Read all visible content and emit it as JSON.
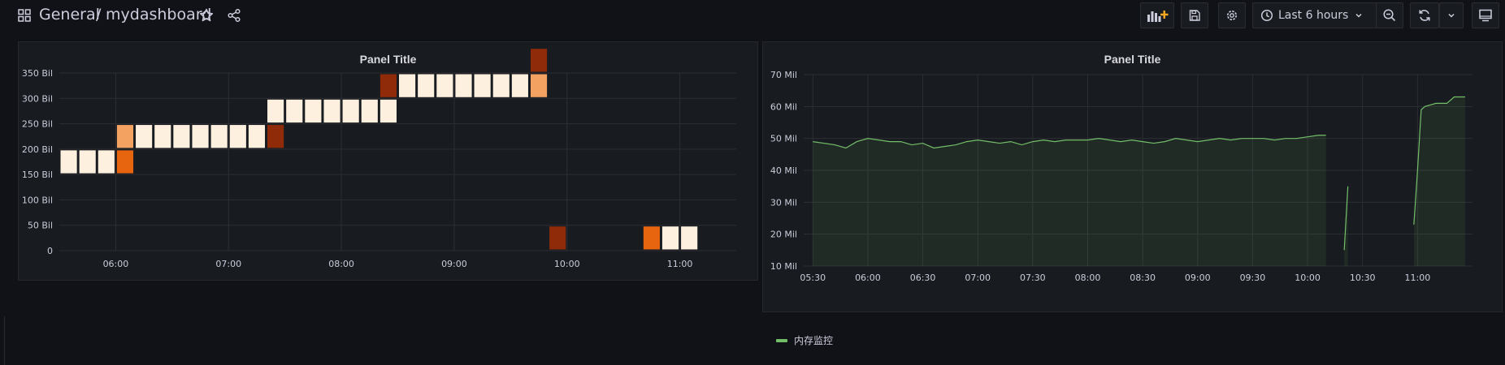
{
  "header": {
    "folder": "General",
    "separator": "/",
    "dashboard": "mydashboard",
    "time_range": "Last 6 hours"
  },
  "toolbar_icons": [
    "add-panel-icon",
    "save-icon",
    "settings-icon",
    "clock-icon",
    "chevron-down-icon",
    "zoom-out-icon",
    "refresh-icon",
    "chevron-down-icon",
    "tv-mode-icon"
  ],
  "colors": {
    "background": "#111217",
    "panel": "#181b1f",
    "series": "#73bf69",
    "heat_low": "#fdf0de",
    "heat_mid": "#f4a261",
    "heat_high": "#e8650f",
    "heat_max": "#8f2b09"
  },
  "panels": [
    {
      "title": "Panel Title",
      "chart_data": {
        "type": "heatmap",
        "x_ticks": [
          "06:00",
          "07:00",
          "08:00",
          "09:00",
          "10:00",
          "11:00"
        ],
        "y_ticks": [
          "0",
          "50 Bil",
          "100 Bil",
          "150 Bil",
          "200 Bil",
          "250 Bil",
          "300 Bil",
          "350 Bil"
        ],
        "ylim": [
          0,
          350
        ],
        "y_unit": "Bil",
        "grid": true,
        "cells": [
          {
            "t": "05:30",
            "y": 200,
            "level": "low"
          },
          {
            "t": "05:40",
            "y": 200,
            "level": "low"
          },
          {
            "t": "05:50",
            "y": 200,
            "level": "low"
          },
          {
            "t": "06:00",
            "y": 200,
            "level": "high"
          },
          {
            "t": "06:00",
            "y": 250,
            "level": "mid"
          },
          {
            "t": "06:10",
            "y": 250,
            "level": "low"
          },
          {
            "t": "06:20",
            "y": 250,
            "level": "low"
          },
          {
            "t": "06:30",
            "y": 250,
            "level": "low"
          },
          {
            "t": "06:40",
            "y": 250,
            "level": "low"
          },
          {
            "t": "06:50",
            "y": 250,
            "level": "low"
          },
          {
            "t": "07:00",
            "y": 250,
            "level": "low"
          },
          {
            "t": "07:10",
            "y": 250,
            "level": "low"
          },
          {
            "t": "07:20",
            "y": 250,
            "level": "max"
          },
          {
            "t": "07:20",
            "y": 300,
            "level": "low"
          },
          {
            "t": "07:30",
            "y": 300,
            "level": "low"
          },
          {
            "t": "07:40",
            "y": 300,
            "level": "low"
          },
          {
            "t": "07:50",
            "y": 300,
            "level": "low"
          },
          {
            "t": "08:00",
            "y": 300,
            "level": "low"
          },
          {
            "t": "08:10",
            "y": 300,
            "level": "low"
          },
          {
            "t": "08:20",
            "y": 300,
            "level": "low"
          },
          {
            "t": "08:20",
            "y": 350,
            "level": "max"
          },
          {
            "t": "08:30",
            "y": 350,
            "level": "low"
          },
          {
            "t": "08:40",
            "y": 350,
            "level": "low"
          },
          {
            "t": "08:50",
            "y": 350,
            "level": "low"
          },
          {
            "t": "09:00",
            "y": 350,
            "level": "low"
          },
          {
            "t": "09:10",
            "y": 350,
            "level": "low"
          },
          {
            "t": "09:20",
            "y": 350,
            "level": "low"
          },
          {
            "t": "09:30",
            "y": 350,
            "level": "low"
          },
          {
            "t": "09:40",
            "y": 350,
            "level": "mid"
          },
          {
            "t": "09:40",
            "y": 400,
            "level": "max"
          },
          {
            "t": "09:50",
            "y": 50,
            "level": "max"
          },
          {
            "t": "10:40",
            "y": 50,
            "level": "high"
          },
          {
            "t": "10:50",
            "y": 50,
            "level": "low"
          },
          {
            "t": "11:00",
            "y": 50,
            "level": "low"
          }
        ]
      }
    },
    {
      "title": "Panel Title",
      "chart_data": {
        "type": "line",
        "x_ticks": [
          "05:30",
          "06:00",
          "06:30",
          "07:00",
          "07:30",
          "08:00",
          "08:30",
          "09:00",
          "09:30",
          "10:00",
          "10:30",
          "11:00"
        ],
        "y_ticks": [
          "10 Mil",
          "20 Mil",
          "30 Mil",
          "40 Mil",
          "50 Mil",
          "60 Mil",
          "70 Mil"
        ],
        "ylim": [
          10,
          70
        ],
        "y_unit": "Mil",
        "grid": true,
        "legend_position": "bottom-left",
        "series": [
          {
            "name": "内存监控",
            "segments": [
              [
                [
                  "05:30",
                  49
                ],
                [
                  "05:36",
                  48.5
                ],
                [
                  "05:42",
                  48
                ],
                [
                  "05:48",
                  47
                ],
                [
                  "05:54",
                  49
                ],
                [
                  "06:00",
                  50
                ],
                [
                  "06:06",
                  49.5
                ],
                [
                  "06:12",
                  49
                ],
                [
                  "06:18",
                  49
                ],
                [
                  "06:24",
                  48
                ],
                [
                  "06:30",
                  48.5
                ],
                [
                  "06:36",
                  47
                ],
                [
                  "06:42",
                  47.5
                ],
                [
                  "06:48",
                  48
                ],
                [
                  "06:54",
                  49
                ],
                [
                  "07:00",
                  49.5
                ],
                [
                  "07:06",
                  49
                ],
                [
                  "07:12",
                  48.5
                ],
                [
                  "07:18",
                  49
                ],
                [
                  "07:24",
                  48
                ],
                [
                  "07:30",
                  49
                ],
                [
                  "07:36",
                  49.5
                ],
                [
                  "07:42",
                  49
                ],
                [
                  "07:48",
                  49.5
                ],
                [
                  "07:54",
                  49.5
                ],
                [
                  "08:00",
                  49.5
                ],
                [
                  "08:06",
                  50
                ],
                [
                  "08:12",
                  49.5
                ],
                [
                  "08:18",
                  49
                ],
                [
                  "08:24",
                  49.5
                ],
                [
                  "08:30",
                  49
                ],
                [
                  "08:36",
                  48.5
                ],
                [
                  "08:42",
                  49
                ],
                [
                  "08:48",
                  50
                ],
                [
                  "08:54",
                  49.5
                ],
                [
                  "09:00",
                  49
                ],
                [
                  "09:06",
                  49.5
                ],
                [
                  "09:12",
                  50
                ],
                [
                  "09:18",
                  49.5
                ],
                [
                  "09:24",
                  50
                ],
                [
                  "09:30",
                  50
                ],
                [
                  "09:36",
                  50
                ],
                [
                  "09:42",
                  49.5
                ],
                [
                  "09:48",
                  50
                ],
                [
                  "09:54",
                  50
                ],
                [
                  "10:00",
                  50.5
                ],
                [
                  "10:06",
                  51
                ],
                [
                  "10:10",
                  51
                ]
              ],
              [
                [
                  "10:20",
                  15
                ],
                [
                  "10:22",
                  35
                ]
              ],
              [
                [
                  "10:58",
                  23
                ],
                [
                  "11:00",
                  40
                ],
                [
                  "11:02",
                  59
                ],
                [
                  "11:04",
                  60
                ],
                [
                  "11:10",
                  61
                ],
                [
                  "11:16",
                  61
                ],
                [
                  "11:20",
                  63
                ],
                [
                  "11:26",
                  63
                ]
              ]
            ]
          }
        ]
      }
    }
  ]
}
